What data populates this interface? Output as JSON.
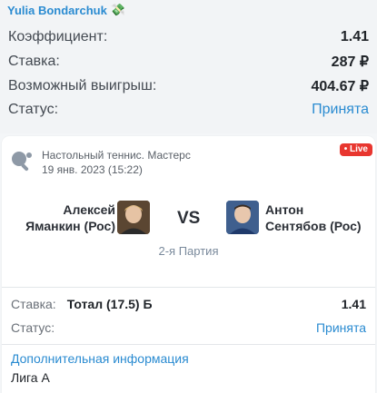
{
  "author": {
    "name": "Yulia Bondarchuk",
    "icon": "money-icon"
  },
  "summary": {
    "coef_label": "Коэффициент:",
    "coef_value": "1.41",
    "stake_label": "Ставка:",
    "stake_value": "287 ₽",
    "win_label": "Возможный выигрыш:",
    "win_value": "404.67 ₽",
    "status_label": "Статус:",
    "status_value": "Принята"
  },
  "event": {
    "sport_icon": "ping-pong-icon",
    "title": "Настольный теннис. Мастерс",
    "date": "19 янв. 2023 (15:22)",
    "live_badge": "• Live",
    "player1_line1": "Алексей",
    "player1_line2": "Яманкин (Рос)",
    "vs": "VS",
    "player2_line1": "Антон",
    "player2_line2": "Сентябов (Рос)",
    "period": "2-я Партия"
  },
  "bet": {
    "stake_label": "Ставка:",
    "market": "Тотал (17.5) Б",
    "odds": "1.41",
    "status_label": "Статус:",
    "status_value": "Принята"
  },
  "info": {
    "title": "Дополнительная информация",
    "value": "Лига А"
  },
  "colors": {
    "accent": "#2a8bd1",
    "live": "#e8362f"
  }
}
